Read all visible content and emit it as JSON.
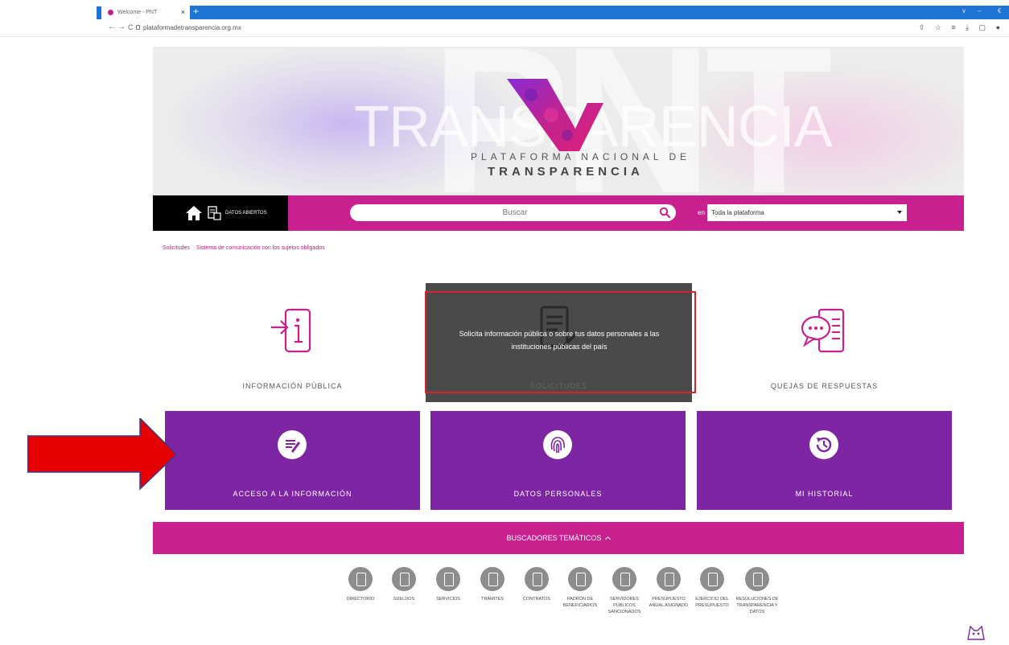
{
  "browser": {
    "tab_title": "Welcome - PNT",
    "tab_close": "×",
    "new_tab": "+",
    "url": "plataformadetransparencia.org.mx",
    "nav_back": "←",
    "nav_forward": "→",
    "nav_reload": "C",
    "toolbar_icons": "⇪ ☆ ≡ ⤓ ▢ ●"
  },
  "hero": {
    "watermark_big": "PNT",
    "watermark_word": "TRANSPARENCIA",
    "line1": "PLATAFORMA NACIONAL DE",
    "line2": "TRANSPARENCIA"
  },
  "navbar": {
    "datos_abiertos": "DATOS ABIERTOS",
    "search_placeholder": "Buscar",
    "scope_prefix": "en",
    "scope_selected": "Toda la plataforma"
  },
  "breadcrumb": {
    "items": [
      "Solicitudes",
      "Sistema de comunicación con los sujetos obligados"
    ]
  },
  "cards": {
    "informacion_publica": "INFORMACIÓN PÚBLICA",
    "solicitudes": "SOLICITUDES",
    "solicitudes_tooltip": "Solicita información pública o sobre tus datos personales a las instituciones públicas del país",
    "quejas": "QUEJAS DE RESPUESTAS",
    "acceso": "ACCESO A LA INFORMACIÓN",
    "datos_personales": "DATOS PERSONALES",
    "historial": "MI HISTORIAL"
  },
  "tematicos": {
    "title": "BUSCADORES TEMÁTICOS",
    "tools": [
      "DIRECTORIO",
      "SUELDOS",
      "SERVICIOS",
      "TRÁMITES",
      "CONTRATOS",
      "PADRÓN DE BENEFICIARIOS",
      "SERVIDORES PÚBLICOS SANCIONADOS",
      "PRESUPUESTO ANUAL ASIGNADO",
      "EJERCICIO DEL PRESUPUESTO",
      "RESOLUCIONES DE TRANSPARENCIA Y DATOS"
    ]
  },
  "colors": {
    "brand_pink": "#c8208f",
    "brand_purple": "#7d25a3",
    "chrome_blue": "#1f73d3",
    "arrow_red": "#e60000"
  }
}
